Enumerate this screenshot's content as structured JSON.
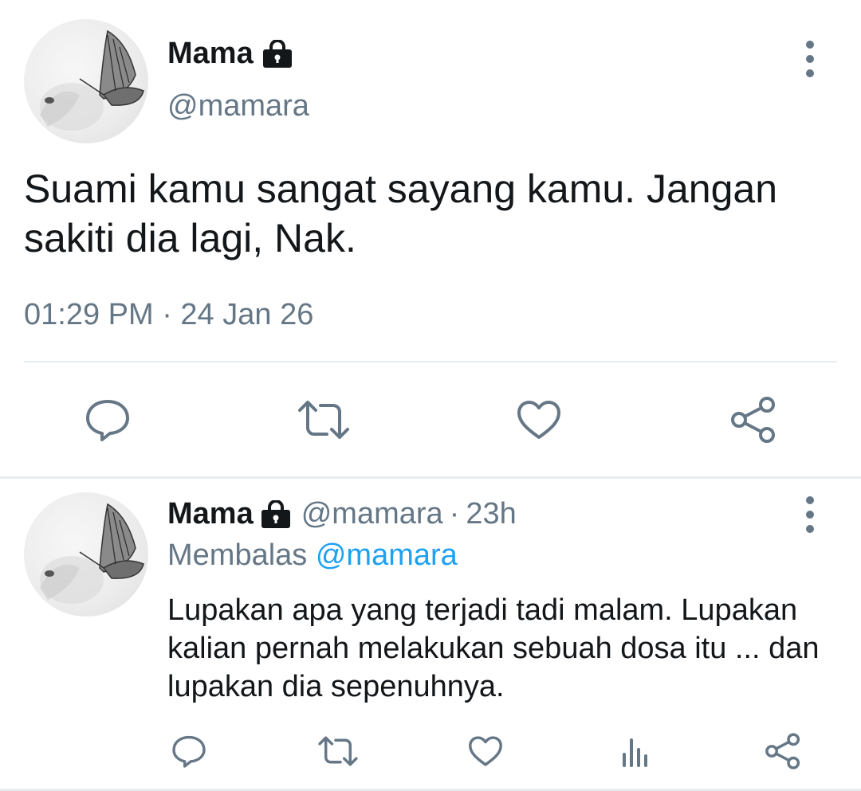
{
  "main_tweet": {
    "user": {
      "name": "Mama",
      "handle": "@mamara"
    },
    "text": "Suami kamu sangat sayang kamu. Jangan sakiti dia lagi, Nak.",
    "timestamp": "01:29 PM · 24 Jan 26",
    "actions": [
      "reply-icon",
      "retweet-icon",
      "like-icon",
      "share-icon"
    ]
  },
  "reply_tweet": {
    "user": {
      "name": "Mama",
      "handle": "@mamara"
    },
    "separator": "·",
    "time": "23h",
    "replying_label": "Membalas",
    "replying_to": "@mamara",
    "text": "Lupakan apa yang terjadi tadi malam. Lupakan kalian pernah melakukan sebuah dosa itu ... dan lupakan dia sepenuhnya.",
    "actions": [
      "reply-icon",
      "retweet-icon",
      "like-icon",
      "analytics-icon",
      "share-icon"
    ]
  },
  "colors": {
    "text_primary": "#14171a",
    "text_secondary": "#657786",
    "icon": "#657786",
    "link": "#1da1f2",
    "divider": "#e6ecf0"
  }
}
